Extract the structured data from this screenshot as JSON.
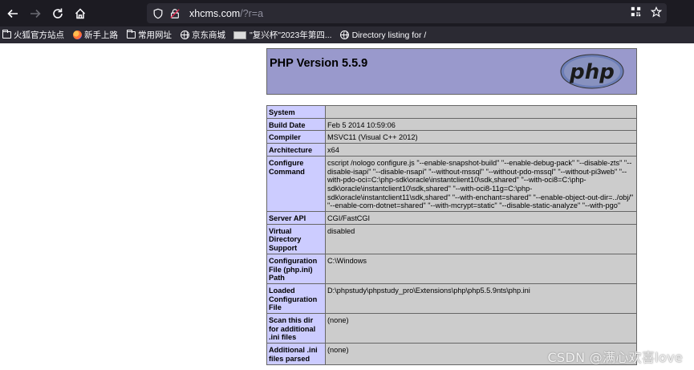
{
  "browser": {
    "url_host": "xhcms.com",
    "url_path": "/?r=a",
    "bookmarks": [
      {
        "label": "火狐官方站点",
        "icon": "folder-icon"
      },
      {
        "label": "新手上路",
        "icon": "firefox-icon"
      },
      {
        "label": "常用网址",
        "icon": "folder-icon"
      },
      {
        "label": "京东商城",
        "icon": "globe-icon"
      },
      {
        "label": "\"复兴杯\"2023年第四...",
        "icon": "thumbnail-icon"
      },
      {
        "label": "Directory listing for /",
        "icon": "globe-icon"
      }
    ]
  },
  "php": {
    "title": "PHP Version 5.5.9",
    "logo_text": "php",
    "rows": [
      {
        "key": "System",
        "value": ""
      },
      {
        "key": "Build Date",
        "value": "Feb 5 2014 10:59:06"
      },
      {
        "key": "Compiler",
        "value": "MSVC11 (Visual C++ 2012)"
      },
      {
        "key": "Architecture",
        "value": "x64"
      },
      {
        "key": "Configure Command",
        "value": "cscript /nologo configure.js \"--enable-snapshot-build\" \"--enable-debug-pack\" \"--disable-zts\" \"--disable-isapi\" \"--disable-nsapi\" \"--without-mssql\" \"--without-pdo-mssql\" \"--without-pi3web\" \"--with-pdo-oci=C:\\php-sdk\\oracle\\instantclient10\\sdk,shared\" \"--with-oci8=C:\\php-sdk\\oracle\\instantclient10\\sdk,shared\" \"--with-oci8-11g=C:\\php-sdk\\oracle\\instantclient11\\sdk,shared\" \"--with-enchant=shared\" \"--enable-object-out-dir=../obj/\" \"--enable-com-dotnet=shared\" \"--with-mcrypt=static\" \"--disable-static-analyze\" \"--with-pgo\""
      },
      {
        "key": "Server API",
        "value": "CGI/FastCGI"
      },
      {
        "key": "Virtual Directory Support",
        "value": "disabled"
      },
      {
        "key": "Configuration File (php.ini) Path",
        "value": "C:\\Windows"
      },
      {
        "key": "Loaded Configuration File",
        "value": "D:\\phpstudy\\phpstudy_pro\\Extensions\\php\\php5.5.9nts\\php.ini"
      },
      {
        "key": "Scan this dir for additional .ini files",
        "value": "(none)"
      },
      {
        "key": "Additional .ini files parsed",
        "value": "(none)"
      }
    ]
  },
  "watermark": "CSDN @满心欢喜love"
}
